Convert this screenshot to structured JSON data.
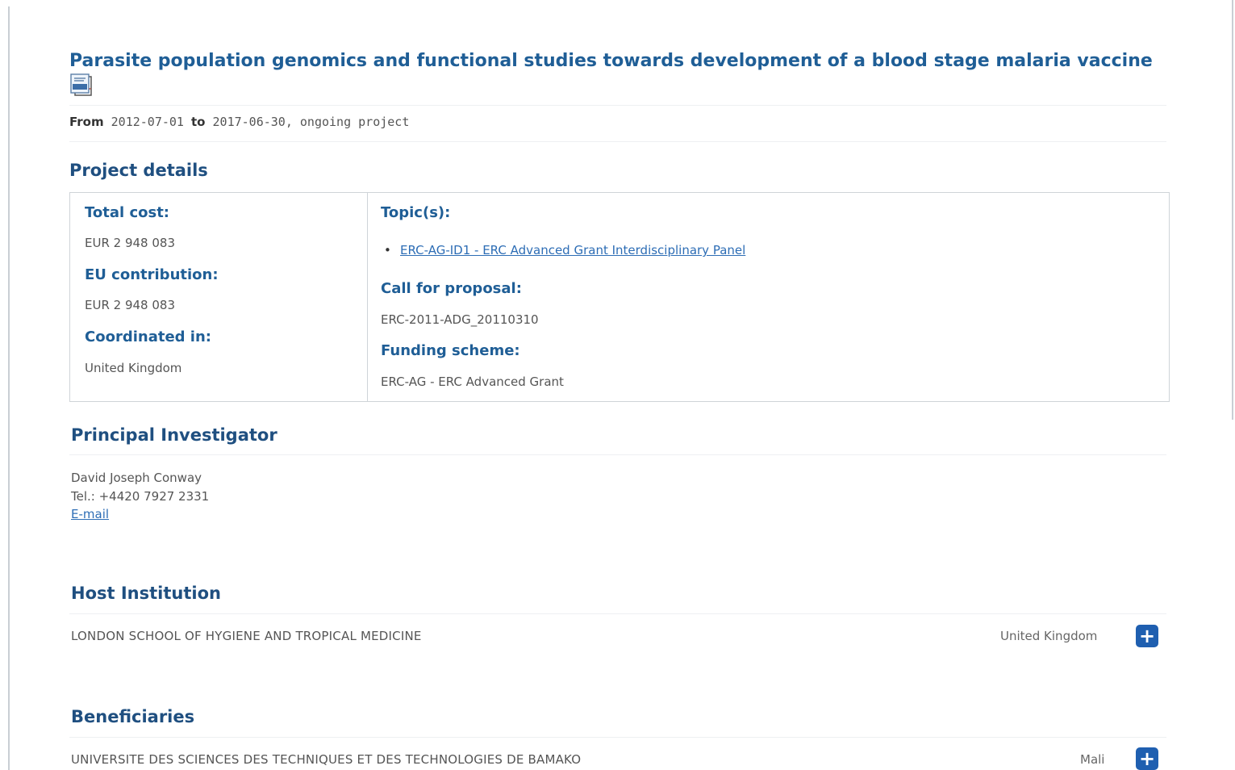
{
  "project": {
    "title": "Parasite population genomics and functional studies towards development of a blood stage malaria vaccine",
    "icons": [
      "pdf-icon",
      "odt-icon"
    ],
    "from_label": "From",
    "from_date": "2012-07-01",
    "to_label": "to",
    "to_date": "2017-06-30, ongoing project"
  },
  "details": {
    "heading": "Project details",
    "total_cost_label": "Total cost:",
    "total_cost_value": "EUR 2 948 083",
    "eu_contribution_label": "EU contribution:",
    "eu_contribution_value": "EUR 2 948 083",
    "coordinated_label": "Coordinated in:",
    "coordinated_value": "United Kingdom",
    "topics_label": "Topic(s):",
    "topics": [
      "ERC-AG-ID1 - ERC Advanced Grant Interdisciplinary Panel"
    ],
    "call_label": "Call for proposal:",
    "call_value": "ERC-2011-ADG_20110310",
    "funding_label": "Funding scheme:",
    "funding_value": "ERC-AG - ERC Advanced Grant"
  },
  "pi": {
    "heading": "Principal Investigator",
    "name": "David Joseph Conway",
    "tel": "Tel.: +4420 7927 2331",
    "email_label": "E-mail"
  },
  "host": {
    "heading": "Host Institution",
    "name": "LONDON SCHOOL OF HYGIENE AND TROPICAL MEDICINE",
    "country": "United Kingdom",
    "expand_symbol": "+"
  },
  "beneficiaries": {
    "heading": "Beneficiaries",
    "items": [
      {
        "name": "UNIVERSITE DES SCIENCES DES TECHNIQUES ET DES TECHNOLOGIES DE BAMAKO",
        "country": "Mali",
        "expand_symbol": "+"
      }
    ]
  },
  "colors": {
    "heading": "#1f4f80",
    "title": "#1f5e96",
    "link": "#2d6db5",
    "button": "#1f5fb0"
  }
}
